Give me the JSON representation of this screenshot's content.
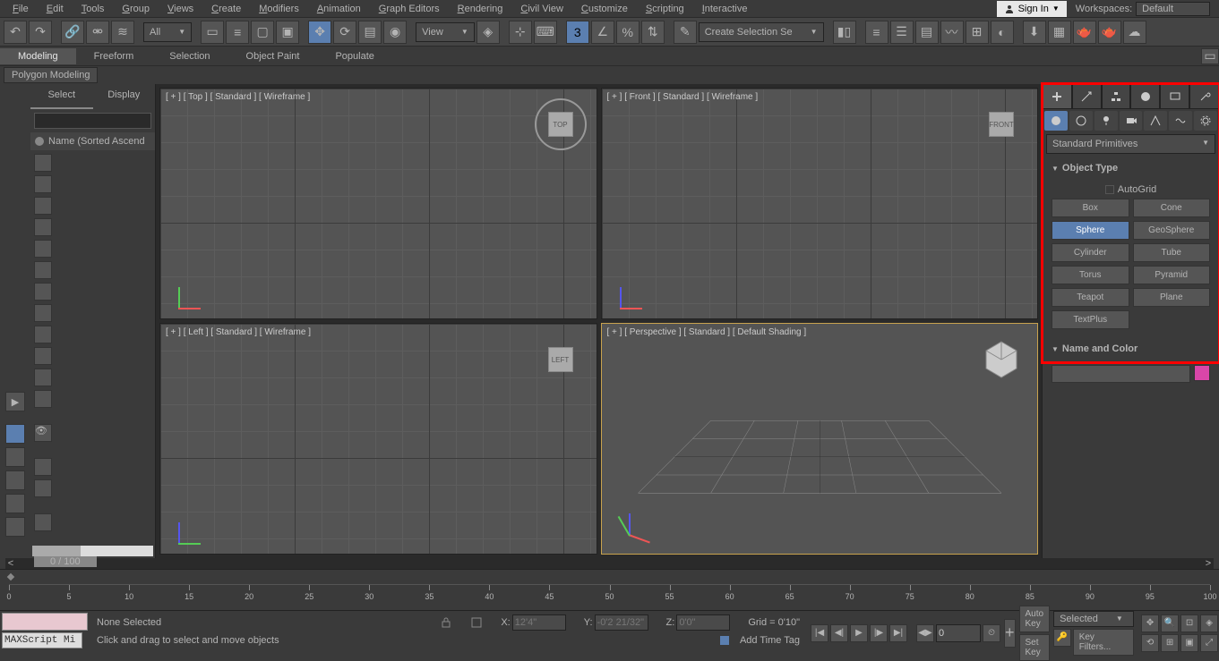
{
  "menubar": {
    "items": [
      "File",
      "Edit",
      "Tools",
      "Group",
      "Views",
      "Create",
      "Modifiers",
      "Animation",
      "Graph Editors",
      "Rendering",
      "Civil View",
      "Customize",
      "Scripting",
      "Interactive"
    ],
    "signin": "Sign In",
    "workspaces_label": "Workspaces:",
    "workspaces_value": "Default"
  },
  "toolbar": {
    "all_dd": "All",
    "view_dd": "View",
    "selset_dd": "Create Selection Se"
  },
  "ribbon": {
    "tabs": [
      "Modeling",
      "Freeform",
      "Selection",
      "Object Paint",
      "Populate"
    ],
    "sub": "Polygon Modeling"
  },
  "scene": {
    "tabs": [
      "Select",
      "Display"
    ],
    "placeholder": "",
    "list_hdr": "Name (Sorted Ascend"
  },
  "viewports": [
    {
      "label": "[ + ] [ Top ] [ Standard ] [ Wireframe ]",
      "cube": "TOP"
    },
    {
      "label": "[ + ] [ Front ] [ Standard ] [ Wireframe ]",
      "cube": "FRONT"
    },
    {
      "label": "[ + ] [ Left ] [ Standard ] [ Wireframe ]",
      "cube": "LEFT"
    },
    {
      "label": "[ + ] [ Perspective ] [ Standard ] [ Default Shading ]",
      "cube": ""
    }
  ],
  "cmd": {
    "primitives_dd": "Standard Primitives",
    "rollout1": "Object Type",
    "autogrid": "AutoGrid",
    "objects": [
      "Box",
      "Cone",
      "Sphere",
      "GeoSphere",
      "Cylinder",
      "Tube",
      "Torus",
      "Pyramid",
      "Teapot",
      "Plane",
      "TextPlus"
    ],
    "active_object": "Sphere",
    "rollout2": "Name and Color",
    "color": "#d946a8"
  },
  "timeline": {
    "frame_display": "0 / 100",
    "ticks": [
      0,
      5,
      10,
      15,
      20,
      25,
      30,
      35,
      40,
      45,
      50,
      55,
      60,
      65,
      70,
      75,
      80,
      85,
      90,
      95,
      100
    ]
  },
  "status": {
    "script_label": "MAXScript Mi",
    "sel_status": "None Selected",
    "hint": "Click and drag to select and move objects",
    "x": "12'4\"",
    "y": "-0'2 21/32\"",
    "z": "0'0\"",
    "grid": "Grid = 0'10\"",
    "time_tag": "Add Time Tag",
    "auto_key": "Auto Key",
    "set_key": "Set Key",
    "selected_dd": "Selected",
    "key_filters": "Key Filters...",
    "frame_input": "0"
  }
}
